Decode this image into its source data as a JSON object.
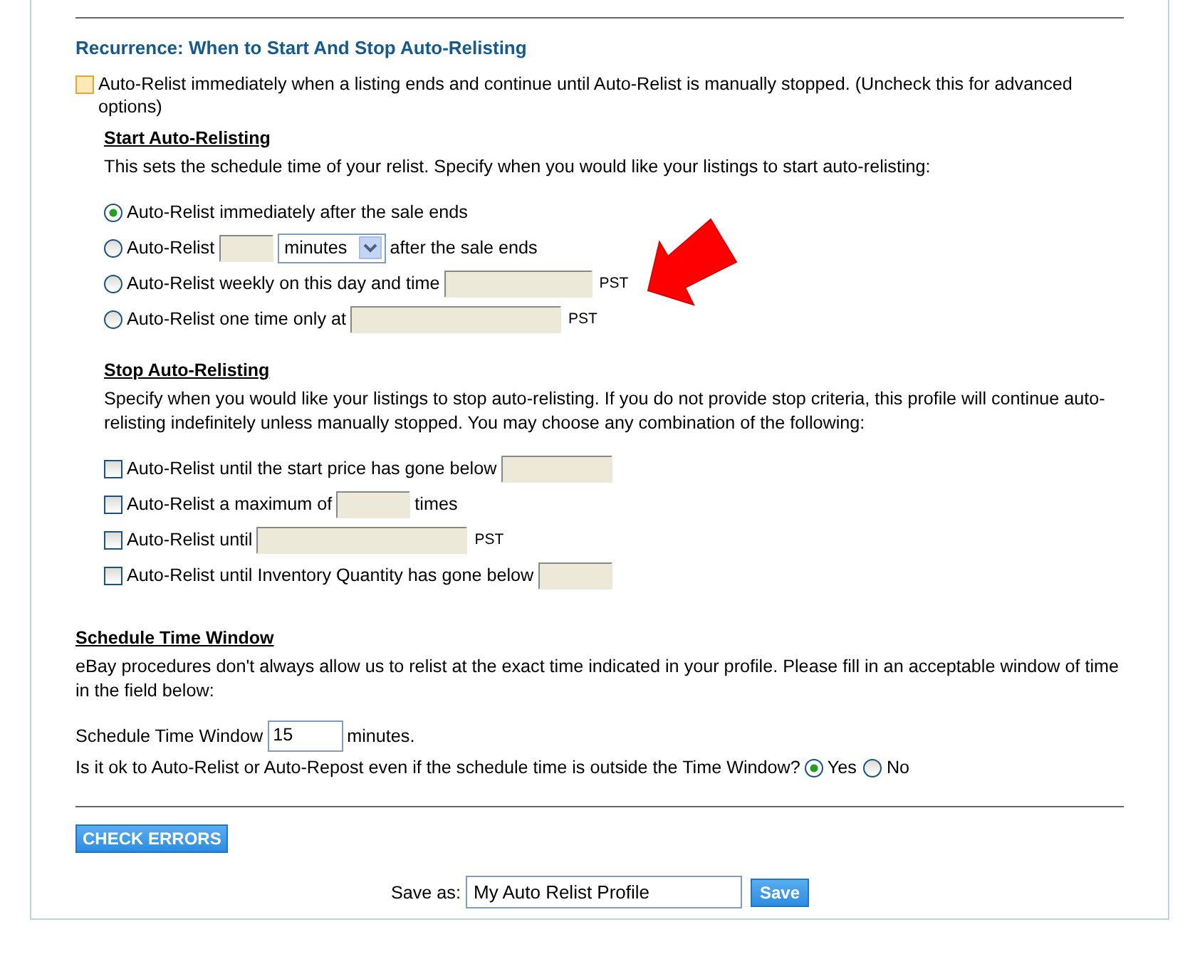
{
  "section_title": "Recurrence: When to Start And Stop Auto-Relisting",
  "master_option": {
    "checked": false,
    "label": "Auto-Relist immediately when a listing ends and continue until Auto-Relist is manually stopped. (Uncheck this for advanced options)"
  },
  "start": {
    "heading": "Start Auto-Relisting",
    "description": "This sets the schedule time of your relist. Specify when you would like your listings to start auto-relisting:",
    "options": [
      {
        "selected": true,
        "label": "Auto-Relist immediately after the sale ends",
        "kind": "plain"
      },
      {
        "selected": false,
        "label": "Auto-Relist",
        "kind": "interval",
        "select": "minutes",
        "suffix": "after the sale ends"
      },
      {
        "selected": false,
        "label": "Auto-Relist weekly on this day and time",
        "kind": "weekly",
        "unit": "PST"
      },
      {
        "selected": false,
        "label": "Auto-Relist one time only at",
        "kind": "once",
        "unit": "PST"
      }
    ]
  },
  "stop": {
    "heading": "Stop Auto-Relisting",
    "description": "Specify when you would like your listings to stop auto-relisting. If you do not provide stop criteria, this profile will continue auto-relisting indefinitely unless manually stopped. You may choose any combination of the following:",
    "options": [
      {
        "checked": false,
        "label": "Auto-Relist until the start price has gone below",
        "kind": "price"
      },
      {
        "checked": false,
        "label": "Auto-Relist a maximum of",
        "kind": "count",
        "suffix": "times"
      },
      {
        "checked": false,
        "label": "Auto-Relist until",
        "kind": "date",
        "unit": "PST"
      },
      {
        "checked": false,
        "label": "Auto-Relist until Inventory Quantity has gone below",
        "kind": "quantity"
      }
    ]
  },
  "schedule": {
    "heading": "Schedule Time Window",
    "description": "eBay procedures don't always allow us to relist at the exact time indicated in your profile. Please fill in an acceptable window of time in the field below:",
    "window_label": "Schedule Time Window",
    "window_value": "15",
    "window_unit": "minutes.",
    "question": "Is it ok to Auto-Relist or Auto-Repost even if the schedule time is outside the Time Window?",
    "answers": [
      {
        "label": "Yes",
        "selected": true
      },
      {
        "label": "No",
        "selected": false
      }
    ]
  },
  "check_button": "CHECK ERRORS",
  "save": {
    "label": "Save as:",
    "value": "My Auto Relist Profile",
    "button": "Save"
  }
}
